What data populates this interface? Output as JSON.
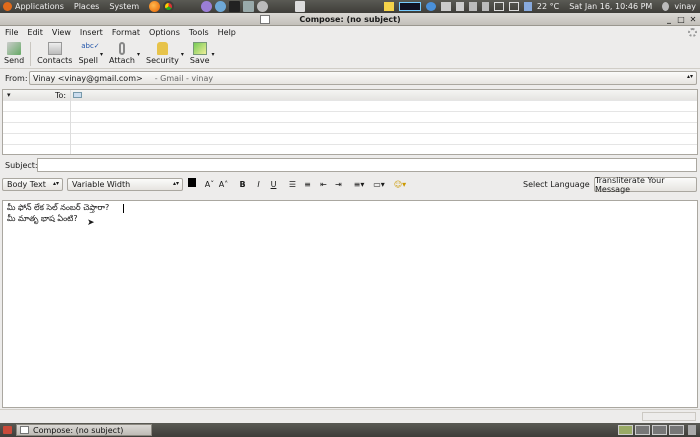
{
  "top_panel": {
    "menus": [
      "Applications",
      "Places",
      "System"
    ],
    "temperature": "22 °C",
    "datetime": "Sat Jan 16, 10:46 PM",
    "user": "vinay"
  },
  "window": {
    "title": "Compose: (no subject)"
  },
  "menu_bar": {
    "items": [
      "File",
      "Edit",
      "View",
      "Insert",
      "Format",
      "Options",
      "Tools",
      "Help"
    ]
  },
  "toolbar": {
    "send": "Send",
    "contacts": "Contacts",
    "spell": "Spell",
    "attach": "Attach",
    "security": "Security",
    "save": "Save"
  },
  "from": {
    "label": "From:",
    "value": "Vinay <vinay@gmail.com>",
    "account": "- Gmail - vinay"
  },
  "recipients": {
    "type_label": "To:"
  },
  "subject": {
    "label": "Subject:",
    "value": ""
  },
  "format_bar": {
    "body_format": "Body Text",
    "width_mode": "Variable Width",
    "select_language": "Select Language",
    "transliterate": "Transliterate Your Message"
  },
  "editor": {
    "lines": [
      "మీ ఫోన్ లేక సెల్ నంబర్ చెప్తారా?",
      "మీ మాతృ భాష ఏంటి?"
    ]
  },
  "taskbar": {
    "task_label": "Compose: (no subject)"
  },
  "colors": {
    "panel": "#3e3d39",
    "window_bg": "#edeceb",
    "firefox": "#e66000"
  }
}
